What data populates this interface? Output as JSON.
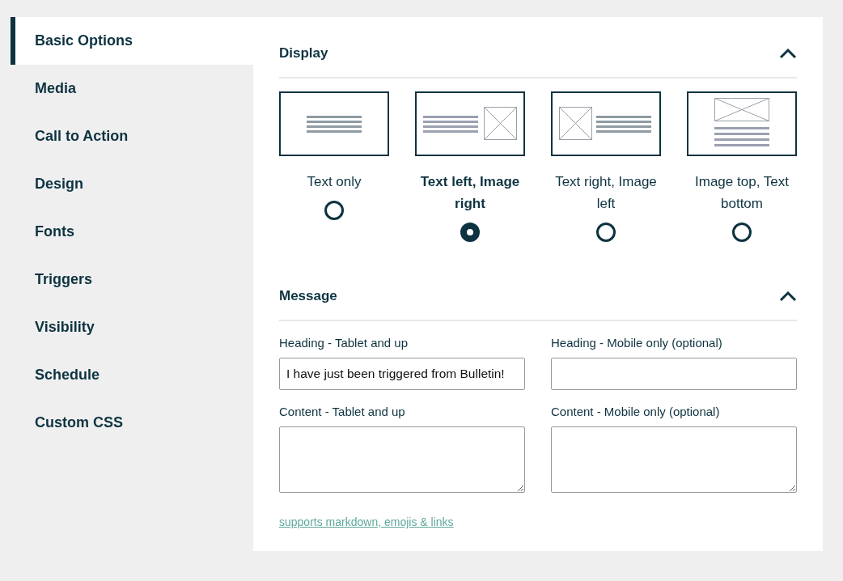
{
  "sidebar": {
    "items": [
      {
        "label": "Basic Options",
        "selected": true
      },
      {
        "label": "Media",
        "selected": false
      },
      {
        "label": "Call to Action",
        "selected": false
      },
      {
        "label": "Design",
        "selected": false
      },
      {
        "label": "Fonts",
        "selected": false
      },
      {
        "label": "Triggers",
        "selected": false
      },
      {
        "label": "Visibility",
        "selected": false
      },
      {
        "label": "Schedule",
        "selected": false
      },
      {
        "label": "Custom CSS",
        "selected": false
      }
    ]
  },
  "display": {
    "title": "Display",
    "expanded": true,
    "options": [
      {
        "kind": "text-only",
        "label": "Text only",
        "selected": false
      },
      {
        "kind": "text-left",
        "label": "Text left, Image right",
        "selected": true
      },
      {
        "kind": "text-right",
        "label": "Text right, Image left",
        "selected": false
      },
      {
        "kind": "image-top",
        "label": "Image top, Text bottom",
        "selected": false
      }
    ]
  },
  "message": {
    "title": "Message",
    "expanded": true,
    "fields": [
      {
        "kind": "input",
        "label": "Heading - Tablet and up",
        "value": "I have just been triggered from Bulletin!"
      },
      {
        "kind": "input",
        "label": "Heading - Mobile only (optional)"
      },
      {
        "kind": "textarea",
        "label": "Content - Tablet and up"
      },
      {
        "kind": "textarea",
        "label": "Content - Mobile only (optional)"
      }
    ],
    "help_link": "supports markdown, emojis & links"
  }
}
